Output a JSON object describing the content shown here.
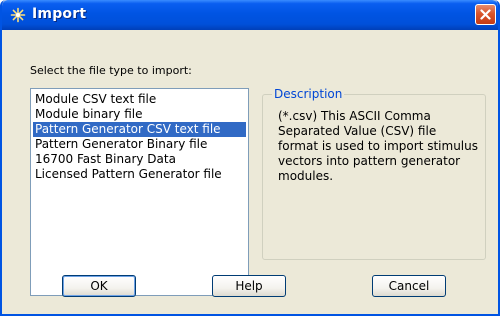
{
  "window": {
    "title": "Import",
    "title_icon": "asterisk-icon",
    "close_icon": "close-icon"
  },
  "prompt": "Select the file type to import:",
  "file_types": [
    {
      "label": "Module CSV text file",
      "selected": false
    },
    {
      "label": "Module binary file",
      "selected": false
    },
    {
      "label": "Pattern Generator CSV text file",
      "selected": true
    },
    {
      "label": "Pattern Generator Binary file",
      "selected": false
    },
    {
      "label": "16700 Fast Binary Data",
      "selected": false
    },
    {
      "label": "Licensed Pattern Generator file",
      "selected": false
    }
  ],
  "description": {
    "legend": "Description",
    "text": "(*.csv) This ASCII Comma Separated Value (CSV) file format is used to import stimulus vectors into pattern generator modules."
  },
  "buttons": {
    "ok": "OK",
    "help": "Help",
    "cancel": "Cancel"
  },
  "colors": {
    "titlebar": "#0054e3",
    "selection": "#316ac5",
    "legend": "#0046d5",
    "close_button": "#d9542b"
  }
}
